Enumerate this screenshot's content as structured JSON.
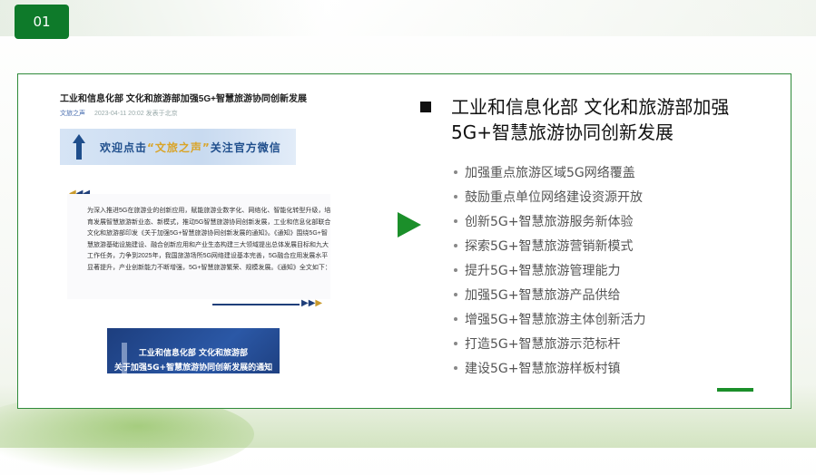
{
  "slide": {
    "number": "01",
    "colors": {
      "accent": "#1b8f2a",
      "badge": "#0e7a2a",
      "frame": "#2f8a3a"
    }
  },
  "article": {
    "title": "工业和信息化部 文化和旅游部加强5G+智慧旅游协同创新发展",
    "meta_source": "文旅之声",
    "meta_date": "2023-04-11 20:02",
    "meta_location": "发表于北京",
    "banner_pre": "欢迎点击",
    "banner_highlight": "“文旅之声”",
    "banner_post": "关注官方微信",
    "paragraph": "为深入推进5G在旅游业的创新应用，赋能旅游业数字化、网络化、智能化转型升级，培育发展智慧旅游新业态、新模式，推动5G智慧旅游协同创新发展，工业和信息化部联合文化和旅游部印发《关于加强5G+智慧旅游协同创新发展的通知》。《通知》围绕5G+智慧旅游基础设施建设、融合创新应用和产业生态构建三大领域提出总体发展目标和九大工作任务，力争到2025年，我国旅游场所5G网络建设基本完善，5G融合应用发展水平显著提升，产业创新能力不断增强，5G+智慧旅游繁荣、规模发展。《通知》全文如下：",
    "cover_line1": "工业和信息化部 文化和旅游部",
    "cover_line2": "关于加强5G+智慧旅游协同创新发展的通知",
    "icons": [
      "arrow-up-icon",
      "chevron-ornament-icon"
    ]
  },
  "content": {
    "heading": "工业和信息化部 文化和旅游部加强5G+智慧旅游协同创新发展",
    "items": [
      "加强重点旅游区域5G网络覆盖",
      "鼓励重点单位网络建设资源开放",
      "创新5G+智慧旅游服务新体验",
      "探索5G+智慧旅游营销新模式",
      "提升5G+智慧旅游管理能力",
      "加强5G+智慧旅游产品供给",
      "增强5G+智慧旅游主体创新活力",
      "打造5G+智慧旅游示范标杆",
      "建设5G+智慧旅游样板村镇"
    ]
  }
}
